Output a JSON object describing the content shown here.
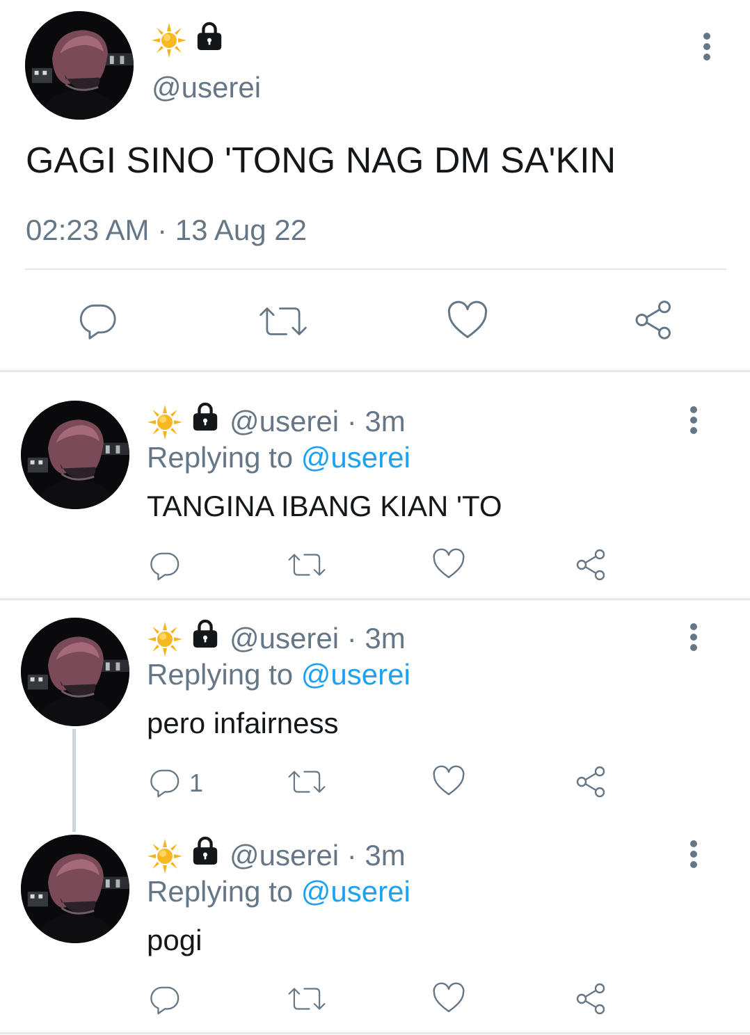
{
  "main_tweet": {
    "display_name_icons": [
      "sun-icon",
      "lock-icon"
    ],
    "handle": "@userei",
    "text": "GAGI SINO 'TONG NAG DM SA'KIN",
    "timestamp": "02:23 AM · 13 Aug 22"
  },
  "replies": [
    {
      "handle": "@userei",
      "age": "· 3m",
      "replying_prefix": "Replying to",
      "replying_to": "@userei",
      "text": "TANGINA IBANG KIAN 'TO",
      "reply_count": ""
    },
    {
      "handle": "@userei",
      "age": "· 3m",
      "replying_prefix": "Replying to",
      "replying_to": "@userei",
      "text": "pero infairness",
      "reply_count": "1"
    },
    {
      "handle": "@userei",
      "age": "· 3m",
      "replying_prefix": "Replying to",
      "replying_to": "@userei",
      "text": "pogi",
      "reply_count": ""
    }
  ],
  "colors": {
    "text": "#14171a",
    "secondary": "#657786",
    "link": "#1da1f2",
    "divider": "#e6e9ec",
    "sun": "#f5b21a"
  }
}
